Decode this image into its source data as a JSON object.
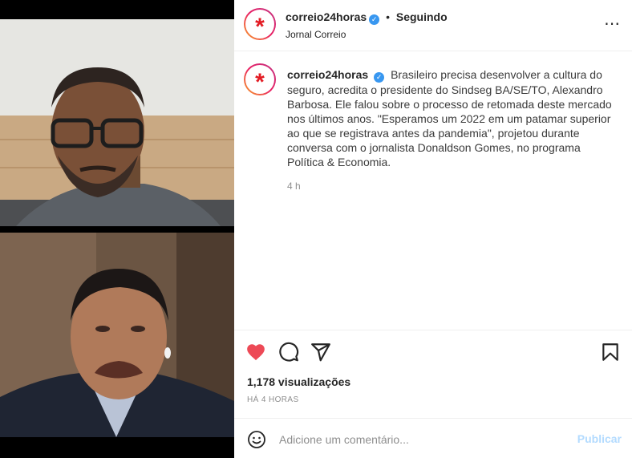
{
  "post": {
    "username": "correio24horas",
    "verified_icon": "verified-badge-icon",
    "following_label": "Seguindo",
    "separator": "•",
    "subtitle": "Jornal Correio",
    "more_icon": "⋯",
    "avatar_glyph": "*",
    "caption": "Brasileiro precisa desenvolver a cultura do seguro, acredita o presidente do Sindseg BA/SE/TO, Alexandro Barbosa. Ele falou sobre o processo de retomada deste mercado nos últimos anos. \"Esperamos um 2022 em um patamar superior ao que se registrava antes da pandemia\", projetou durante conversa com o jornalista Donaldson Gomes, no programa Política & Economia.",
    "caption_time": "4 h",
    "views": "1,178 visualizações",
    "posted_ago": "HÁ 4 HORAS"
  },
  "actions": {
    "like_icon": "heart-filled-icon",
    "comment_icon": "comment-bubble-icon",
    "share_icon": "paper-plane-icon",
    "save_icon": "bookmark-icon",
    "liked": true
  },
  "comment_box": {
    "placeholder": "Adicione um comentário...",
    "publish_label": "Publicar",
    "emoji_icon": "smiley-icon"
  },
  "colors": {
    "like_red": "#ed4956",
    "brand_red": "#e31b23",
    "publish_disabled": "#b3dbff",
    "verified_blue": "#3897f0"
  }
}
